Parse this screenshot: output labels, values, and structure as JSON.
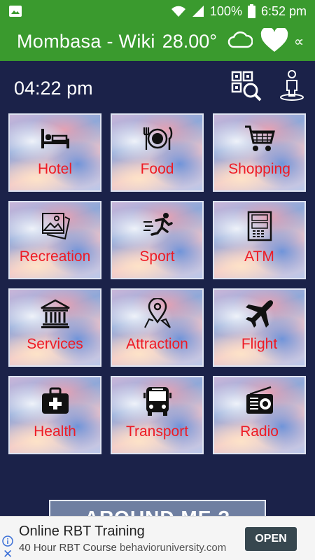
{
  "status_bar": {
    "battery": "100%",
    "time": "6:52 pm"
  },
  "app_bar": {
    "title": "Mombasa - Wiki",
    "temperature": "28.00°",
    "share_icon": "share-icon"
  },
  "time_display": "04:22 pm",
  "tiles": [
    {
      "label": "Hotel",
      "icon": "bed-icon"
    },
    {
      "label": "Food",
      "icon": "plate-cutlery-icon"
    },
    {
      "label": "Shopping",
      "icon": "shopping-cart-icon"
    },
    {
      "label": "Recreation",
      "icon": "image-gallery-icon"
    },
    {
      "label": "Sport",
      "icon": "running-person-icon"
    },
    {
      "label": "ATM",
      "icon": "atm-machine-icon"
    },
    {
      "label": "Services",
      "icon": "bank-building-icon"
    },
    {
      "label": "Attraction",
      "icon": "map-pin-icon"
    },
    {
      "label": "Flight",
      "icon": "airplane-icon"
    },
    {
      "label": "Health",
      "icon": "medical-kit-icon"
    },
    {
      "label": "Transport",
      "icon": "bus-icon"
    },
    {
      "label": "Radio",
      "icon": "radio-icon"
    }
  ],
  "around_me_button": "AROUND ME ?",
  "ad": {
    "headline": "Online RBT Training",
    "subline": "40 Hour RBT Course",
    "domain": "behavioruniversity.com",
    "cta": "OPEN"
  },
  "colors": {
    "app_bar": "#3a9a2e",
    "background": "#1b2249",
    "tile_label": "#ee1b24"
  }
}
